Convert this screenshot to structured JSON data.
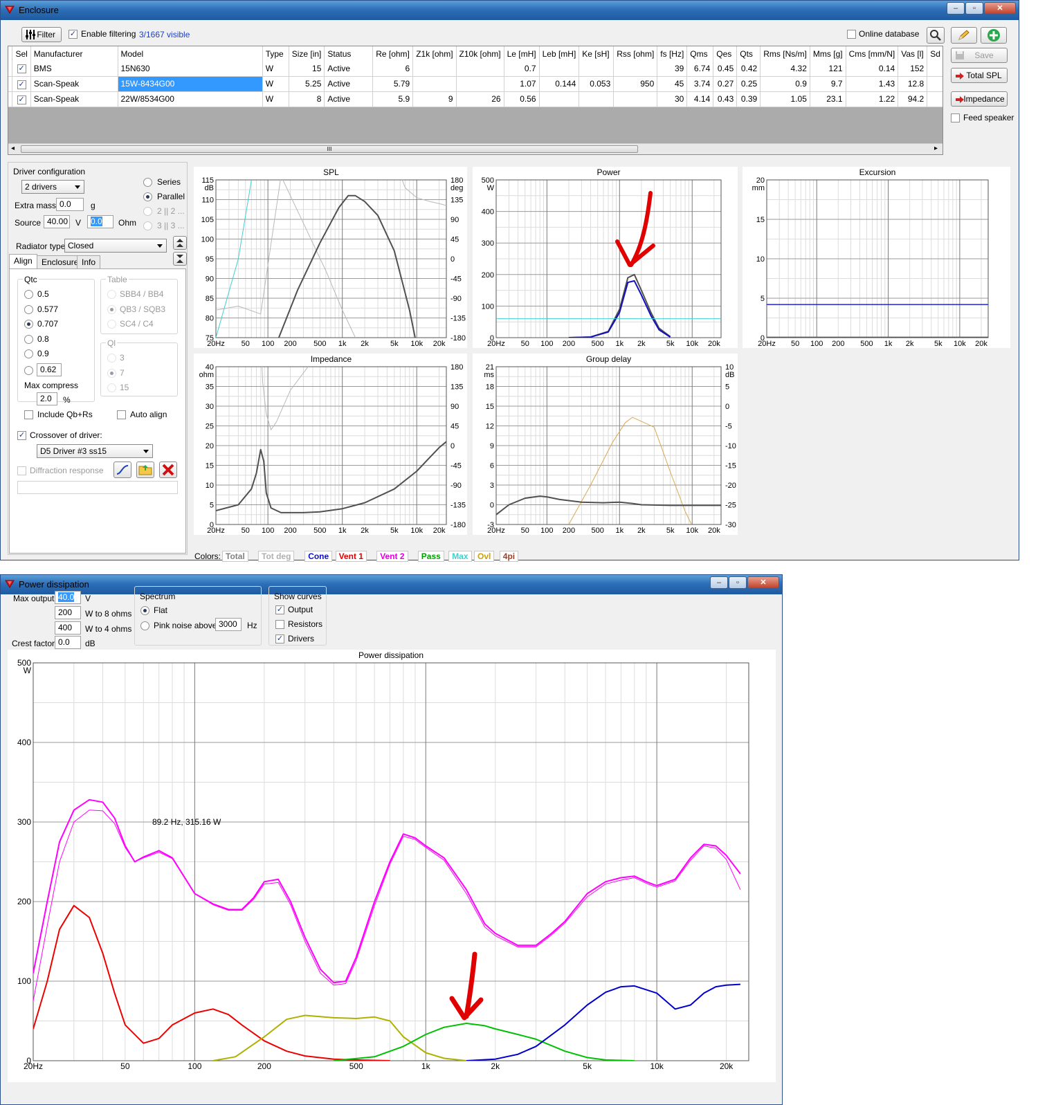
{
  "enclosure_window": {
    "title": "Enclosure",
    "toolbar": {
      "filter_label": "Filter",
      "enable_filtering_label": "Enable filtering",
      "enable_filtering_checked": true,
      "visible_count": "3/1667 visible",
      "online_database_label": "Online database"
    },
    "table": {
      "columns": [
        "Sel",
        "Manufacturer",
        "Model",
        "Type",
        "Size [in]",
        "Status",
        "Re [ohm]",
        "Z1k [ohm]",
        "Z10k [ohm]",
        "Le [mH]",
        "Leb [mH]",
        "Ke [sH]",
        "Rss [ohm]",
        "fs [Hz]",
        "Qms",
        "Qes",
        "Qts",
        "Rms [Ns/m]",
        "Mms [g]",
        "Cms [mm/N]",
        "Vas [l]",
        "Sd"
      ],
      "rows": [
        [
          "BMS",
          "15N630",
          "W",
          "15",
          "Active",
          "6",
          "",
          "",
          "0.7",
          "",
          "",
          "",
          "39",
          "6.74",
          "0.45",
          "0.42",
          "4.32",
          "121",
          "0.14",
          "152"
        ],
        [
          "Scan-Speak",
          "15W-8434G00",
          "W",
          "5.25",
          "Active",
          "5.79",
          "",
          "",
          "1.07",
          "0.144",
          "0.053",
          "950",
          "45",
          "3.74",
          "0.27",
          "0.25",
          "0.9",
          "9.7",
          "1.43",
          "12.8"
        ],
        [
          "Scan-Speak",
          "22W/8534G00",
          "W",
          "8",
          "Active",
          "5.9",
          "9",
          "26",
          "0.56",
          "",
          "",
          "",
          "30",
          "4.14",
          "0.43",
          "0.39",
          "1.05",
          "23.1",
          "1.22",
          "94.2"
        ]
      ],
      "scroll_marker": "III"
    },
    "side_buttons": {
      "save": "Save",
      "total_spl": "Total SPL",
      "impedance": "Impedance",
      "feed_speaker": "Feed speaker"
    },
    "driver_config": {
      "title": "Driver configuration",
      "drivers_select": "2 drivers",
      "series": "Series",
      "parallel": "Parallel",
      "opt3": "2 || 2 ...",
      "opt4": "3 || 3 ...",
      "extra_mass_label": "Extra mass",
      "extra_mass_value": "0.0",
      "extra_mass_unit": "g",
      "source_label": "Source",
      "source_value": "40.00",
      "source_unit": "V",
      "ohm_value": "0.0",
      "ohm_unit": "Ohm",
      "radiator_label": "Radiator type",
      "radiator_value": "Closed"
    },
    "tabs": [
      "Align",
      "Enclosure",
      "Info"
    ],
    "align": {
      "qtc_title": "Qtc",
      "qtc_options": [
        "0.5",
        "0.577",
        "0.707",
        "0.8",
        "0.9"
      ],
      "qtc_custom": "0.62",
      "table_title": "Table",
      "table_options": [
        "SBB4 / BB4",
        "QB3 / SQB3",
        "SC4 / C4"
      ],
      "ql_title": "Ql",
      "ql_options": [
        "3",
        "7",
        "15"
      ],
      "max_compress_label": "Max compress",
      "max_compress_value": "2.0",
      "max_compress_unit": "%",
      "include_qb_label": "Include Qb+Rs",
      "auto_align_label": "Auto align"
    },
    "crossover_label": "Crossover of driver:",
    "crossover_value": "D5 Driver #3 ss15",
    "diffraction_label": "Diffraction response",
    "colors_label": "Colors:",
    "color_legend": [
      {
        "label": "Total",
        "color": "#808080"
      },
      {
        "label": "Tot deg",
        "color": "#b0b0b0"
      },
      {
        "label": "Cone",
        "color": "#1010c0"
      },
      {
        "label": "Vent 1",
        "color": "#e00000"
      },
      {
        "label": "Vent 2",
        "color": "#e000e0"
      },
      {
        "label": "Pass",
        "color": "#00a000"
      },
      {
        "label": "Max",
        "color": "#40d0d0"
      },
      {
        "label": "Ovl",
        "color": "#d0a000"
      },
      {
        "label": "4pi",
        "color": "#a04020"
      }
    ]
  },
  "charts_top": {
    "freq_ticks": [
      "20Hz",
      "50",
      "100",
      "200",
      "500",
      "1k",
      "2k",
      "5k",
      "10k",
      "20k"
    ],
    "spl": {
      "title": "SPL",
      "yunit": "dB",
      "yticks": [
        "115",
        "110",
        "105",
        "100",
        "95",
        "90",
        "85",
        "80",
        "75"
      ],
      "y2unit": "deg",
      "y2ticks": [
        "180",
        "135",
        "90",
        "45",
        "0",
        "-45",
        "-90",
        "-135",
        "-180"
      ]
    },
    "power": {
      "title": "Power",
      "yunit": "W",
      "yticks": [
        "500",
        "400",
        "300",
        "200",
        "100",
        "0"
      ]
    },
    "excursion": {
      "title": "Excursion",
      "yunit": "mm",
      "yticks": [
        "20",
        "15",
        "10",
        "5",
        "0"
      ]
    },
    "impedance": {
      "title": "Impedance",
      "yunit": "ohm",
      "yticks": [
        "40",
        "35",
        "30",
        "25",
        "20",
        "15",
        "10",
        "5",
        "0"
      ],
      "y2ticks": [
        "180",
        "135",
        "90",
        "45",
        "0",
        "-45",
        "-90",
        "-135",
        "-180"
      ]
    },
    "group_delay": {
      "title": "Group delay",
      "yunit": "ms",
      "yticks": [
        "21",
        "18",
        "15",
        "12",
        "9",
        "6",
        "3",
        "0",
        "-3"
      ],
      "y2unit": "dB",
      "y2ticks": [
        "10",
        "5",
        "0",
        "-5",
        "-10",
        "-15",
        "-20",
        "-25",
        "-30"
      ]
    }
  },
  "power_window": {
    "title": "Power dissipation",
    "max_output_label": "Max output",
    "max_output_value": "40.0",
    "max_output_unit": "V",
    "w8_value": "200",
    "w8_label": "W to 8 ohms",
    "w4_value": "400",
    "w4_label": "W to 4 ohms",
    "crest_label": "Crest factor",
    "crest_value": "0.0",
    "crest_unit": "dB",
    "spectrum_title": "Spectrum",
    "flat_label": "Flat",
    "pink_label": "Pink noise above",
    "pink_value": "3000",
    "pink_unit": "Hz",
    "show_curves_title": "Show curves",
    "output_label": "Output",
    "resistors_label": "Resistors",
    "drivers_label": "Drivers",
    "cursor_readout": "89.2 Hz, 315.16 W"
  },
  "chart_data": [
    {
      "type": "line",
      "title": "Power",
      "xscale": "log",
      "xlim": [
        20,
        25000
      ],
      "ylim": [
        0,
        500
      ],
      "ylabel": "W",
      "series": [
        {
          "color": "#505050",
          "x": [
            200,
            400,
            700,
            1000,
            1300,
            1600,
            2000,
            2700,
            3500,
            5000
          ],
          "values": [
            0,
            2,
            20,
            90,
            190,
            200,
            150,
            80,
            30,
            3
          ]
        },
        {
          "color": "#1010c0",
          "x": [
            200,
            400,
            700,
            1000,
            1300,
            1600,
            2000,
            2700,
            3500,
            5000
          ],
          "values": [
            0,
            2,
            18,
            80,
            175,
            180,
            135,
            70,
            25,
            2
          ]
        },
        {
          "color": "#40d0d0",
          "x": [
            20,
            25000
          ],
          "values": [
            60,
            60
          ]
        }
      ]
    },
    {
      "type": "line",
      "title": "Power dissipation",
      "xscale": "log",
      "xlim": [
        20,
        25000
      ],
      "ylim": [
        0,
        500
      ],
      "ylabel": "W",
      "xticks": [
        "20Hz",
        "50",
        "100",
        "200",
        "500",
        "1k",
        "2k",
        "5k",
        "10k",
        "20k"
      ],
      "yticks": [
        "500",
        "400",
        "300",
        "200",
        "100",
        "0"
      ],
      "series": [
        {
          "color": "#ff00ff",
          "x": [
            20,
            23,
            26,
            30,
            35,
            40,
            45,
            50,
            55,
            60,
            70,
            80,
            100,
            120,
            140,
            160,
            180,
            200,
            230,
            260,
            300,
            350,
            400,
            450,
            500,
            600,
            700,
            800,
            900,
            1000,
            1200,
            1500,
            1800,
            2000,
            2500,
            3000,
            3500,
            4000,
            5000,
            6000,
            7000,
            8000,
            9000,
            10000,
            12000,
            14000,
            16000,
            18000,
            20000,
            23000
          ],
          "values": [
            110,
            200,
            275,
            315,
            328,
            325,
            305,
            270,
            250,
            256,
            264,
            255,
            210,
            197,
            190,
            190,
            205,
            225,
            228,
            200,
            155,
            115,
            98,
            100,
            130,
            200,
            250,
            285,
            280,
            270,
            255,
            215,
            172,
            160,
            145,
            145,
            160,
            175,
            210,
            225,
            230,
            232,
            225,
            220,
            228,
            255,
            272,
            270,
            258,
            235
          ]
        },
        {
          "color": "#ff00ff",
          "x": [
            20,
            23,
            26,
            30,
            35,
            40,
            45,
            50,
            55,
            60,
            70,
            80,
            100,
            120,
            140,
            160,
            180,
            200,
            230,
            260,
            300,
            350,
            400,
            450,
            500,
            600,
            700,
            800,
            900,
            1000,
            1200,
            1500,
            1800,
            2000,
            2500,
            3000,
            3500,
            4000,
            5000,
            6000,
            7000,
            8000,
            9000,
            10000,
            12000,
            14000,
            16000,
            18000,
            20000,
            23000
          ],
          "values": [
            75,
            170,
            250,
            300,
            315,
            314,
            298,
            268,
            250,
            255,
            262,
            254,
            210,
            196,
            189,
            189,
            203,
            222,
            224,
            196,
            150,
            110,
            95,
            97,
            126,
            195,
            247,
            282,
            278,
            268,
            252,
            210,
            168,
            157,
            143,
            143,
            158,
            173,
            206,
            222,
            227,
            230,
            223,
            218,
            226,
            252,
            270,
            267,
            253,
            215
          ]
        },
        {
          "color": "#ee0000",
          "x": [
            20,
            23,
            26,
            30,
            35,
            40,
            45,
            50,
            60,
            70,
            80,
            100,
            120,
            140,
            160,
            200,
            250,
            300,
            400,
            500,
            700
          ],
          "values": [
            40,
            100,
            165,
            195,
            180,
            135,
            85,
            45,
            22,
            28,
            45,
            60,
            65,
            58,
            45,
            25,
            12,
            6,
            2,
            1,
            0
          ]
        },
        {
          "color": "#b0b000",
          "x": [
            120,
            150,
            200,
            250,
            300,
            400,
            500,
            600,
            700,
            800,
            1000,
            1200,
            1500
          ],
          "values": [
            0,
            5,
            30,
            52,
            57,
            54,
            53,
            55,
            50,
            30,
            10,
            3,
            0
          ]
        },
        {
          "color": "#00c000",
          "x": [
            400,
            600,
            800,
            1000,
            1200,
            1500,
            1800,
            2000,
            2500,
            3000,
            4000,
            5000,
            6000,
            8000
          ],
          "values": [
            0,
            5,
            18,
            33,
            42,
            47,
            44,
            40,
            33,
            27,
            12,
            4,
            1,
            0
          ]
        },
        {
          "color": "#0000cc",
          "x": [
            1500,
            2000,
            2500,
            3000,
            4000,
            5000,
            6000,
            7000,
            8000,
            10000,
            12000,
            14000,
            16000,
            18000,
            20000,
            23000
          ],
          "values": [
            0,
            2,
            8,
            18,
            45,
            70,
            86,
            93,
            94,
            85,
            65,
            70,
            85,
            93,
            95,
            96
          ]
        }
      ]
    }
  ]
}
